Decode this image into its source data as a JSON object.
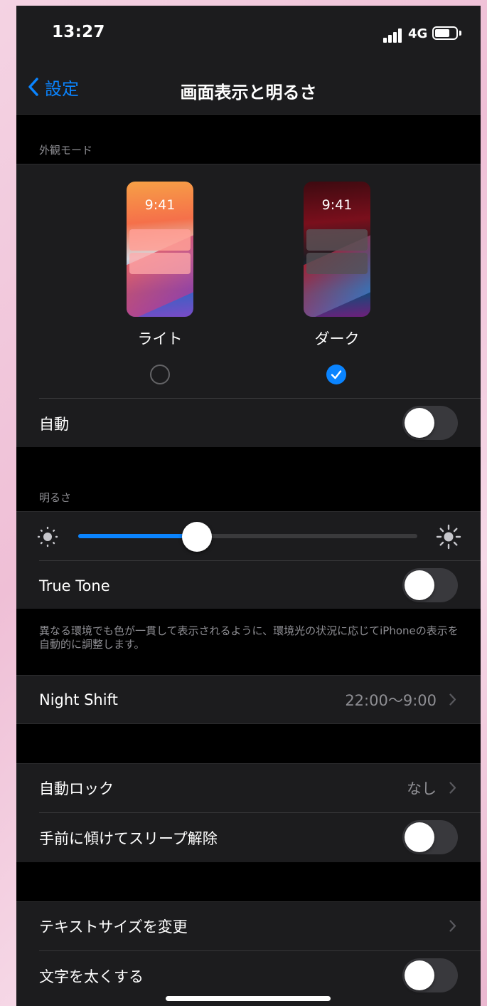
{
  "status_bar": {
    "time": "13:27",
    "network": "4G",
    "battery_level": 0.7
  },
  "nav": {
    "back_label": "設定",
    "title": "画面表示と明るさ"
  },
  "appearance": {
    "header": "外観モード",
    "light": {
      "preview_time": "9:41",
      "label": "ライト",
      "selected": false
    },
    "dark": {
      "preview_time": "9:41",
      "label": "ダーク",
      "selected": true
    },
    "auto_label": "自動",
    "auto_on": false
  },
  "brightness": {
    "header": "明るさ",
    "level": 0.35,
    "true_tone_label": "True Tone",
    "true_tone_on": false,
    "true_tone_footer": "異なる環境でも色が一貫して表示されるように、環境光の状況に応じてiPhoneの表示を自動的に調整します。"
  },
  "night_shift": {
    "label": "Night Shift",
    "value": "22:00〜9:00"
  },
  "lock": {
    "auto_lock_label": "自動ロック",
    "auto_lock_value": "なし",
    "raise_to_wake_label": "手前に傾けてスリープ解除",
    "raise_to_wake_on": false
  },
  "text": {
    "text_size_label": "テキストサイズを変更",
    "bold_text_label": "文字を太くする",
    "bold_text_on": false
  },
  "colors": {
    "accent": "#0a84ff",
    "background": "#000000",
    "cell": "#1c1c1e",
    "secondary_text": "#8e8e93",
    "toggle_off": "#39393d"
  }
}
